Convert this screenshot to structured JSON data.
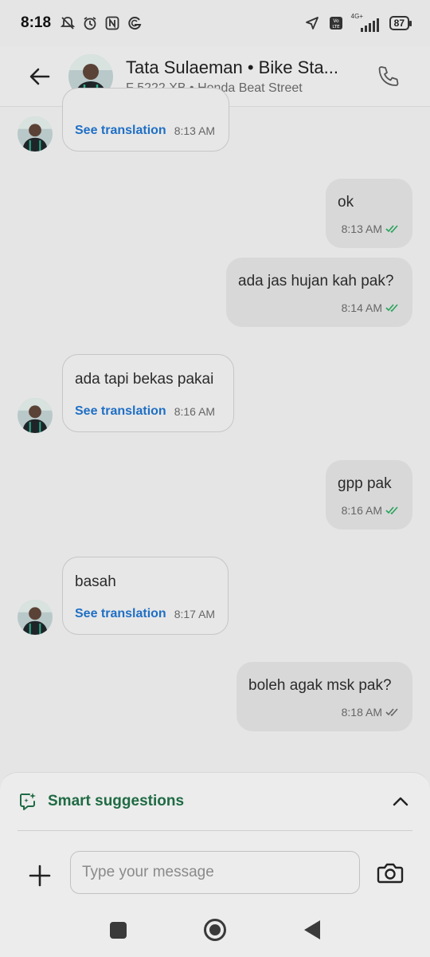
{
  "status_bar": {
    "time": "8:18",
    "network_label": "4G+",
    "battery": "87"
  },
  "header": {
    "name": "Tata Sulaeman • Bike Sta...",
    "subtitle": "F 5222 XB • Honda Beat Street"
  },
  "messages": [
    {
      "direction": "in",
      "text": "",
      "translate_label": "See translation",
      "time": "8:13 AM"
    },
    {
      "direction": "out",
      "text": "ok",
      "time": "8:13 AM",
      "status": "read"
    },
    {
      "direction": "out",
      "text": "ada jas hujan kah pak?",
      "time": "8:14 AM",
      "status": "read"
    },
    {
      "direction": "in",
      "text": "ada tapi bekas pakai",
      "translate_label": "See translation",
      "time": "8:16 AM"
    },
    {
      "direction": "out",
      "text": "gpp pak",
      "time": "8:16 AM",
      "status": "read"
    },
    {
      "direction": "in",
      "text": "basah",
      "translate_label": "See translation",
      "time": "8:17 AM"
    },
    {
      "direction": "out",
      "text": "boleh agak msk pak?",
      "time": "8:18 AM",
      "status": "delivered"
    }
  ],
  "smart_suggestions": {
    "label": "Smart suggestions"
  },
  "composer": {
    "placeholder": "Type your message"
  },
  "colors": {
    "read_tick": "#27a35a",
    "delivered_tick": "#666666",
    "translation_link": "#1f6fc5",
    "smart_label": "#1f6b44"
  }
}
